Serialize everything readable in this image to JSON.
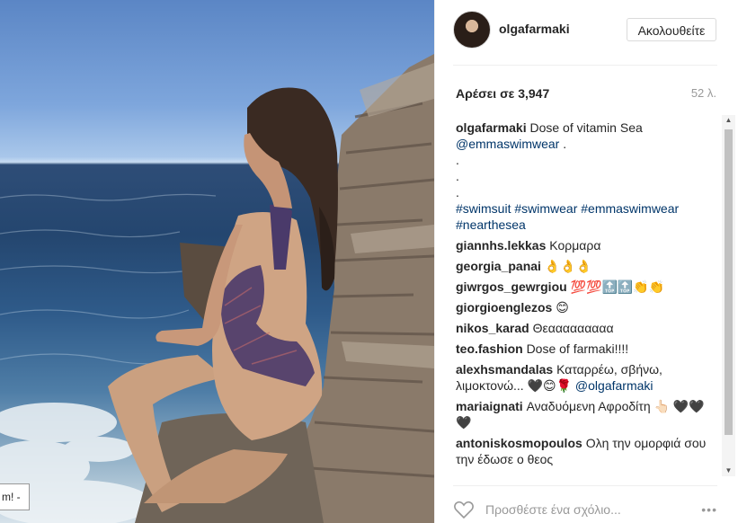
{
  "photo": {
    "alt": "",
    "notification_text": "m! -"
  },
  "header": {
    "username": "olgafarmaki",
    "follow_label": "Ακολουθείτε"
  },
  "stats": {
    "likes": "Αρέσει σε 3,947",
    "age": "52 λ."
  },
  "caption": {
    "user": "olgafarmaki",
    "text": "Dose of vitamin Sea",
    "mention": "@emmaswimwear",
    "mention_after": " .",
    "dots": [
      ".",
      ".",
      "."
    ],
    "hashtags": "#swimsuit #swimwear #emmaswimwear #nearthesea"
  },
  "comments": [
    {
      "user": "giannhs.lekkas",
      "text": "Κορμαρα"
    },
    {
      "user": "georgia_panai",
      "text": "👌👌👌"
    },
    {
      "user": "giwrgos_gewrgiou",
      "text": "💯💯🔝🔝👏👏"
    },
    {
      "user": "giorgioenglezos",
      "text": "😊"
    },
    {
      "user": "nikos_karad",
      "text": "Θεααααααααα"
    },
    {
      "user": "teo.fashion",
      "text": "Dose of farmaki!!!!"
    },
    {
      "user": "alexhsmandalas",
      "text": "Καταρρέω, σβήνω, λιμοκτονώ... 🖤😊🌹",
      "mention": "@olgafarmaki"
    },
    {
      "user": "mariaignati",
      "text": "Αναδυόμενη Αφροδίτη 👆🏻 🖤🖤🖤"
    },
    {
      "user": "antoniskosmopoulos",
      "text": "Ολη την ομορφιά σου την έδωσε ο θεος"
    }
  ],
  "add_comment": {
    "placeholder": "Προσθέστε ένα σχόλιο...",
    "more": "•••"
  },
  "icons": {
    "heart": "heart-icon",
    "more": "more-options-icon",
    "scroll_up": "scroll-up-arrow-icon",
    "scroll_down": "scroll-down-arrow-icon"
  },
  "colors": {
    "link": "#003569",
    "muted": "#999999",
    "text": "#262626"
  }
}
